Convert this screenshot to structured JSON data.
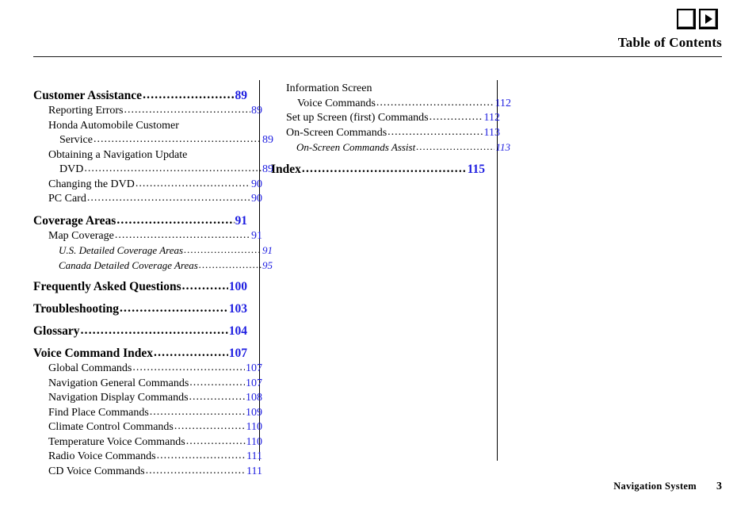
{
  "header": {
    "title": "Table of Contents",
    "buttons": [
      {
        "name": "blank-button",
        "glyph": ""
      },
      {
        "name": "next-button",
        "glyph": "play-triangle"
      }
    ]
  },
  "footer": {
    "label": "Navigation System",
    "page": "3"
  },
  "colors": {
    "page_number": "#1c1ce0",
    "text": "#000000",
    "rule": "#1a1a1a"
  },
  "columns": {
    "left": [
      {
        "level": 1,
        "label": "Customer Assistance",
        "page": "89"
      },
      {
        "level": 2,
        "label": "Reporting Errors",
        "page": "89"
      },
      {
        "level": 2,
        "label": "Honda Automobile Customer",
        "page": "",
        "wrap": true
      },
      {
        "level": 2,
        "label": "Service",
        "page": "89",
        "cont": true
      },
      {
        "level": 2,
        "label": "Obtaining a Navigation Update",
        "page": "",
        "wrap": true
      },
      {
        "level": 2,
        "label": "DVD",
        "page": "89",
        "cont": true
      },
      {
        "level": 2,
        "label": "Changing the DVD",
        "page": "90"
      },
      {
        "level": 2,
        "label": "PC Card",
        "page": "90"
      },
      {
        "level": 1,
        "label": "Coverage Areas",
        "page": "91"
      },
      {
        "level": 2,
        "label": "Map Coverage",
        "page": "91"
      },
      {
        "level": 3,
        "label": "U.S. Detailed Coverage Areas",
        "page": "91"
      },
      {
        "level": 3,
        "label": "Canada Detailed Coverage Areas",
        "page": "95"
      },
      {
        "level": 1,
        "label": "Frequently Asked Questions",
        "page": "100"
      },
      {
        "level": 1,
        "label": "Troubleshooting",
        "page": "103"
      },
      {
        "level": 1,
        "label": "Glossary",
        "page": "104"
      },
      {
        "level": 1,
        "label": "Voice Command Index",
        "page": "107"
      },
      {
        "level": 2,
        "label": "Global Commands",
        "page": "107"
      },
      {
        "level": 2,
        "label": "Navigation General Commands",
        "page": "107"
      },
      {
        "level": 2,
        "label": "Navigation Display Commands",
        "page": "108"
      },
      {
        "level": 2,
        "label": "Find Place Commands",
        "page": "109"
      },
      {
        "level": 2,
        "label": "Climate Control Commands",
        "page": "110"
      },
      {
        "level": 2,
        "label": "Temperature Voice Commands",
        "page": "110"
      },
      {
        "level": 2,
        "label": "Radio Voice Commands",
        "page": "111"
      },
      {
        "level": 2,
        "label": "CD Voice Commands",
        "page": "111"
      }
    ],
    "right": [
      {
        "level": 2,
        "label": "Information Screen",
        "page": "",
        "wrap": true
      },
      {
        "level": 2,
        "label": "Voice Commands",
        "page": "112",
        "cont": true
      },
      {
        "level": 2,
        "label": "Set up Screen (first) Commands",
        "page": "112"
      },
      {
        "level": 2,
        "label": "On-Screen Commands",
        "page": "113"
      },
      {
        "level": 3,
        "label": "On-Screen Commands Assist",
        "page": "113"
      },
      {
        "level": 1,
        "label": "Index",
        "page": "115"
      }
    ]
  }
}
